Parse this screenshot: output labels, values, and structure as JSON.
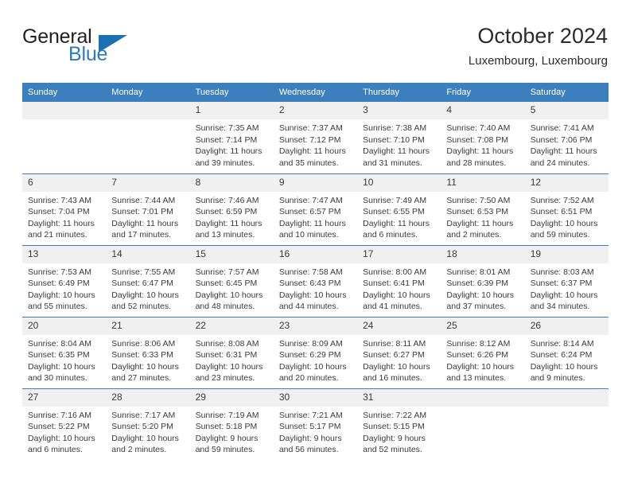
{
  "brand": {
    "name_part1": "General",
    "name_part2": "Blue",
    "triangle_color": "#1a6fb5",
    "text_color": "#231f20",
    "accent_color": "#2b7cbf"
  },
  "header": {
    "month_title": "October 2024",
    "location": "Luxembourg, Luxembourg",
    "header_bg": "#3c7fbe",
    "daynum_bg": "#f0f0f0"
  },
  "weekday_headers": [
    "Sunday",
    "Monday",
    "Tuesday",
    "Wednesday",
    "Thursday",
    "Friday",
    "Saturday"
  ],
  "labels": {
    "sunrise_prefix": "Sunrise:",
    "sunset_prefix": "Sunset:",
    "daylight_prefix": "Daylight:"
  },
  "weeks": [
    [
      {
        "day": "",
        "blank": true
      },
      {
        "day": "",
        "blank": true
      },
      {
        "day": "1",
        "sunrise": "Sunrise: 7:35 AM",
        "sunset": "Sunset: 7:14 PM",
        "daylight": "Daylight: 11 hours and 39 minutes."
      },
      {
        "day": "2",
        "sunrise": "Sunrise: 7:37 AM",
        "sunset": "Sunset: 7:12 PM",
        "daylight": "Daylight: 11 hours and 35 minutes."
      },
      {
        "day": "3",
        "sunrise": "Sunrise: 7:38 AM",
        "sunset": "Sunset: 7:10 PM",
        "daylight": "Daylight: 11 hours and 31 minutes."
      },
      {
        "day": "4",
        "sunrise": "Sunrise: 7:40 AM",
        "sunset": "Sunset: 7:08 PM",
        "daylight": "Daylight: 11 hours and 28 minutes."
      },
      {
        "day": "5",
        "sunrise": "Sunrise: 7:41 AM",
        "sunset": "Sunset: 7:06 PM",
        "daylight": "Daylight: 11 hours and 24 minutes."
      }
    ],
    [
      {
        "day": "6",
        "sunrise": "Sunrise: 7:43 AM",
        "sunset": "Sunset: 7:04 PM",
        "daylight": "Daylight: 11 hours and 21 minutes."
      },
      {
        "day": "7",
        "sunrise": "Sunrise: 7:44 AM",
        "sunset": "Sunset: 7:01 PM",
        "daylight": "Daylight: 11 hours and 17 minutes."
      },
      {
        "day": "8",
        "sunrise": "Sunrise: 7:46 AM",
        "sunset": "Sunset: 6:59 PM",
        "daylight": "Daylight: 11 hours and 13 minutes."
      },
      {
        "day": "9",
        "sunrise": "Sunrise: 7:47 AM",
        "sunset": "Sunset: 6:57 PM",
        "daylight": "Daylight: 11 hours and 10 minutes."
      },
      {
        "day": "10",
        "sunrise": "Sunrise: 7:49 AM",
        "sunset": "Sunset: 6:55 PM",
        "daylight": "Daylight: 11 hours and 6 minutes."
      },
      {
        "day": "11",
        "sunrise": "Sunrise: 7:50 AM",
        "sunset": "Sunset: 6:53 PM",
        "daylight": "Daylight: 11 hours and 2 minutes."
      },
      {
        "day": "12",
        "sunrise": "Sunrise: 7:52 AM",
        "sunset": "Sunset: 6:51 PM",
        "daylight": "Daylight: 10 hours and 59 minutes."
      }
    ],
    [
      {
        "day": "13",
        "sunrise": "Sunrise: 7:53 AM",
        "sunset": "Sunset: 6:49 PM",
        "daylight": "Daylight: 10 hours and 55 minutes."
      },
      {
        "day": "14",
        "sunrise": "Sunrise: 7:55 AM",
        "sunset": "Sunset: 6:47 PM",
        "daylight": "Daylight: 10 hours and 52 minutes."
      },
      {
        "day": "15",
        "sunrise": "Sunrise: 7:57 AM",
        "sunset": "Sunset: 6:45 PM",
        "daylight": "Daylight: 10 hours and 48 minutes."
      },
      {
        "day": "16",
        "sunrise": "Sunrise: 7:58 AM",
        "sunset": "Sunset: 6:43 PM",
        "daylight": "Daylight: 10 hours and 44 minutes."
      },
      {
        "day": "17",
        "sunrise": "Sunrise: 8:00 AM",
        "sunset": "Sunset: 6:41 PM",
        "daylight": "Daylight: 10 hours and 41 minutes."
      },
      {
        "day": "18",
        "sunrise": "Sunrise: 8:01 AM",
        "sunset": "Sunset: 6:39 PM",
        "daylight": "Daylight: 10 hours and 37 minutes."
      },
      {
        "day": "19",
        "sunrise": "Sunrise: 8:03 AM",
        "sunset": "Sunset: 6:37 PM",
        "daylight": "Daylight: 10 hours and 34 minutes."
      }
    ],
    [
      {
        "day": "20",
        "sunrise": "Sunrise: 8:04 AM",
        "sunset": "Sunset: 6:35 PM",
        "daylight": "Daylight: 10 hours and 30 minutes."
      },
      {
        "day": "21",
        "sunrise": "Sunrise: 8:06 AM",
        "sunset": "Sunset: 6:33 PM",
        "daylight": "Daylight: 10 hours and 27 minutes."
      },
      {
        "day": "22",
        "sunrise": "Sunrise: 8:08 AM",
        "sunset": "Sunset: 6:31 PM",
        "daylight": "Daylight: 10 hours and 23 minutes."
      },
      {
        "day": "23",
        "sunrise": "Sunrise: 8:09 AM",
        "sunset": "Sunset: 6:29 PM",
        "daylight": "Daylight: 10 hours and 20 minutes."
      },
      {
        "day": "24",
        "sunrise": "Sunrise: 8:11 AM",
        "sunset": "Sunset: 6:27 PM",
        "daylight": "Daylight: 10 hours and 16 minutes."
      },
      {
        "day": "25",
        "sunrise": "Sunrise: 8:12 AM",
        "sunset": "Sunset: 6:26 PM",
        "daylight": "Daylight: 10 hours and 13 minutes."
      },
      {
        "day": "26",
        "sunrise": "Sunrise: 8:14 AM",
        "sunset": "Sunset: 6:24 PM",
        "daylight": "Daylight: 10 hours and 9 minutes."
      }
    ],
    [
      {
        "day": "27",
        "sunrise": "Sunrise: 7:16 AM",
        "sunset": "Sunset: 5:22 PM",
        "daylight": "Daylight: 10 hours and 6 minutes."
      },
      {
        "day": "28",
        "sunrise": "Sunrise: 7:17 AM",
        "sunset": "Sunset: 5:20 PM",
        "daylight": "Daylight: 10 hours and 2 minutes."
      },
      {
        "day": "29",
        "sunrise": "Sunrise: 7:19 AM",
        "sunset": "Sunset: 5:18 PM",
        "daylight": "Daylight: 9 hours and 59 minutes."
      },
      {
        "day": "30",
        "sunrise": "Sunrise: 7:21 AM",
        "sunset": "Sunset: 5:17 PM",
        "daylight": "Daylight: 9 hours and 56 minutes."
      },
      {
        "day": "31",
        "sunrise": "Sunrise: 7:22 AM",
        "sunset": "Sunset: 5:15 PM",
        "daylight": "Daylight: 9 hours and 52 minutes."
      },
      {
        "day": "",
        "blank": true
      },
      {
        "day": "",
        "blank": true
      }
    ]
  ]
}
